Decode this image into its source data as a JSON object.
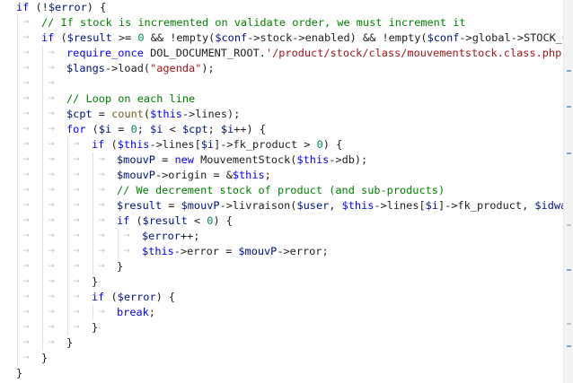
{
  "code_lines": [
    {
      "indent": 0,
      "tokens": [
        [
          "kw",
          "if"
        ],
        [
          "op",
          " (!"
        ],
        [
          "var",
          "$error"
        ],
        [
          "op",
          ") {"
        ]
      ]
    },
    {
      "indent": 1,
      "tokens": [
        [
          "cmt",
          "// If stock is incremented on validate order, we must increment it"
        ]
      ]
    },
    {
      "indent": 1,
      "tokens": [
        [
          "kw",
          "if"
        ],
        [
          "op",
          " ("
        ],
        [
          "var",
          "$result"
        ],
        [
          "op",
          " >= "
        ],
        [
          "num",
          "0"
        ],
        [
          "op",
          " && !empty("
        ],
        [
          "var",
          "$conf"
        ],
        [
          "op",
          "->stock->enabled) && !empty("
        ],
        [
          "var",
          "$conf"
        ],
        [
          "op",
          "->global->STOCK_CALC"
        ]
      ]
    },
    {
      "indent": 2,
      "tokens": [
        [
          "kw",
          "require_once"
        ],
        [
          "op",
          " DOL_DOCUMENT_ROOT."
        ],
        [
          "str",
          "'/product/stock/class/mouvementstock.class.php'"
        ],
        [
          "op",
          ";"
        ]
      ]
    },
    {
      "indent": 2,
      "tokens": [
        [
          "var",
          "$langs"
        ],
        [
          "op",
          "->load("
        ],
        [
          "str",
          "\"agenda\""
        ],
        [
          "op",
          ");"
        ]
      ]
    },
    {
      "indent": 2,
      "tokens": []
    },
    {
      "indent": 2,
      "tokens": [
        [
          "cmt",
          "// Loop on each line"
        ]
      ]
    },
    {
      "indent": 2,
      "tokens": [
        [
          "var",
          "$cpt"
        ],
        [
          "op",
          " = "
        ],
        [
          "fn",
          "count"
        ],
        [
          "op",
          "("
        ],
        [
          "kw",
          "$this"
        ],
        [
          "op",
          "->lines);"
        ]
      ]
    },
    {
      "indent": 2,
      "tokens": [
        [
          "kw",
          "for"
        ],
        [
          "op",
          " ("
        ],
        [
          "var",
          "$i"
        ],
        [
          "op",
          " = "
        ],
        [
          "num",
          "0"
        ],
        [
          "op",
          "; "
        ],
        [
          "var",
          "$i"
        ],
        [
          "op",
          " < "
        ],
        [
          "var",
          "$cpt"
        ],
        [
          "op",
          "; "
        ],
        [
          "var",
          "$i"
        ],
        [
          "op",
          "++) {"
        ]
      ]
    },
    {
      "indent": 3,
      "tokens": [
        [
          "kw",
          "if"
        ],
        [
          "op",
          " ("
        ],
        [
          "kw",
          "$this"
        ],
        [
          "op",
          "->lines["
        ],
        [
          "var",
          "$i"
        ],
        [
          "op",
          "]->fk_product > "
        ],
        [
          "num",
          "0"
        ],
        [
          "op",
          ") {"
        ]
      ]
    },
    {
      "indent": 4,
      "tokens": [
        [
          "var",
          "$mouvP"
        ],
        [
          "op",
          " = "
        ],
        [
          "kw",
          "new"
        ],
        [
          "op",
          " MouvementStock("
        ],
        [
          "kw",
          "$this"
        ],
        [
          "op",
          "->db);"
        ]
      ]
    },
    {
      "indent": 4,
      "tokens": [
        [
          "var",
          "$mouvP"
        ],
        [
          "op",
          "->origin = &"
        ],
        [
          "kw",
          "$this"
        ],
        [
          "op",
          ";"
        ]
      ]
    },
    {
      "indent": 4,
      "tokens": [
        [
          "cmt",
          "// We decrement stock of product (and sub-products)"
        ]
      ]
    },
    {
      "indent": 4,
      "tokens": [
        [
          "var",
          "$result"
        ],
        [
          "op",
          " = "
        ],
        [
          "var",
          "$mouvP"
        ],
        [
          "op",
          "->livraison("
        ],
        [
          "var",
          "$user"
        ],
        [
          "op",
          ", "
        ],
        [
          "kw",
          "$this"
        ],
        [
          "op",
          "->lines["
        ],
        [
          "var",
          "$i"
        ],
        [
          "op",
          "]->fk_product, "
        ],
        [
          "var",
          "$idwareh"
        ]
      ]
    },
    {
      "indent": 4,
      "tokens": [
        [
          "kw",
          "if"
        ],
        [
          "op",
          " ("
        ],
        [
          "var",
          "$result"
        ],
        [
          "op",
          " < "
        ],
        [
          "num",
          "0"
        ],
        [
          "op",
          ") {"
        ]
      ]
    },
    {
      "indent": 5,
      "tokens": [
        [
          "var",
          "$error"
        ],
        [
          "op",
          "++;"
        ]
      ]
    },
    {
      "indent": 5,
      "tokens": [
        [
          "kw",
          "$this"
        ],
        [
          "op",
          "->error = "
        ],
        [
          "var",
          "$mouvP"
        ],
        [
          "op",
          "->error;"
        ]
      ]
    },
    {
      "indent": 4,
      "tokens": [
        [
          "op",
          "}"
        ]
      ]
    },
    {
      "indent": 3,
      "tokens": [
        [
          "op",
          "}"
        ]
      ]
    },
    {
      "indent": 3,
      "tokens": [
        [
          "kw",
          "if"
        ],
        [
          "op",
          " ("
        ],
        [
          "var",
          "$error"
        ],
        [
          "op",
          ") {"
        ]
      ]
    },
    {
      "indent": 4,
      "tokens": [
        [
          "kw",
          "break"
        ],
        [
          "op",
          ";"
        ]
      ]
    },
    {
      "indent": 3,
      "tokens": [
        [
          "op",
          "}"
        ]
      ]
    },
    {
      "indent": 2,
      "tokens": [
        [
          "op",
          "}"
        ]
      ]
    },
    {
      "indent": 1,
      "tokens": [
        [
          "op",
          "}"
        ]
      ]
    },
    {
      "indent": 0,
      "tokens": [
        [
          "op",
          "}"
        ]
      ]
    }
  ],
  "colors": {
    "keyword": "#0000ff",
    "variable": "#001080",
    "string": "#a31515",
    "number": "#098658",
    "comment": "#008000",
    "function": "#795e26",
    "whitespace_marker": "#c3c3c3",
    "indent_guide": "#e3e3e3"
  },
  "whitespace_marker_icon": "tab-arrow-icon"
}
